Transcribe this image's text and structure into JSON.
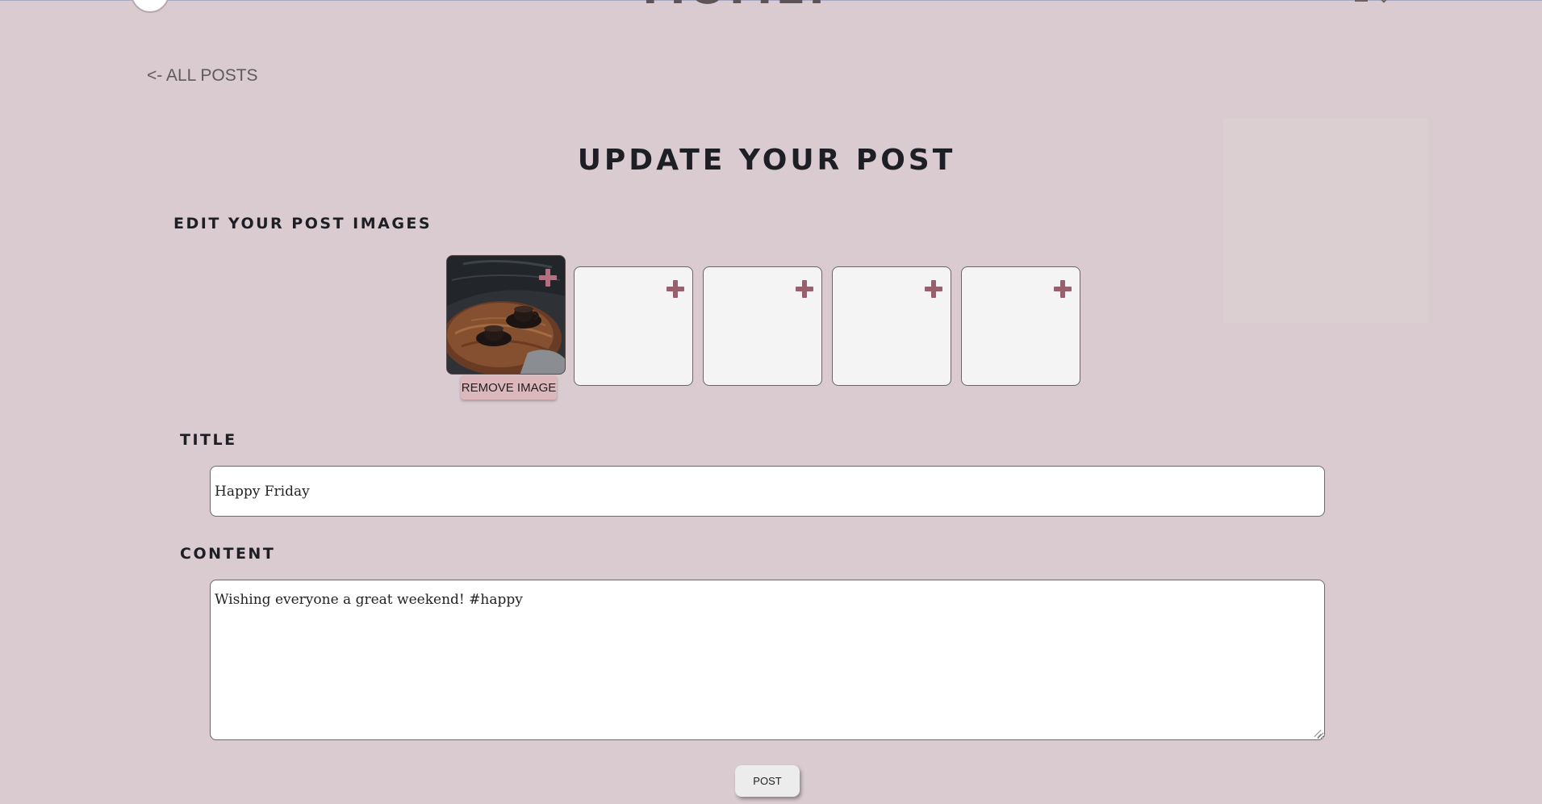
{
  "header": {
    "brand": "MOMENT"
  },
  "nav": {
    "back_label": "<- ALL POSTS"
  },
  "page": {
    "title": "UPDATE YOUR POST"
  },
  "images": {
    "section_label": "EDIT YOUR POST IMAGES",
    "remove_label": "REMOVE IMAGE",
    "slots": [
      {
        "filled": true,
        "content": "photo of coffee cups on a wooden table"
      },
      {
        "filled": false
      },
      {
        "filled": false
      },
      {
        "filled": false
      },
      {
        "filled": false
      }
    ]
  },
  "form": {
    "title_label": "TITLE",
    "title_value": "Happy Friday",
    "content_label": "CONTENT",
    "content_value": "Wishing everyone a great weekend! #happy",
    "submit_label": "POST"
  },
  "colors": {
    "background": "#d9cbcf",
    "accent": "#9b5e6c",
    "remove_button": "#dcb7bb"
  }
}
